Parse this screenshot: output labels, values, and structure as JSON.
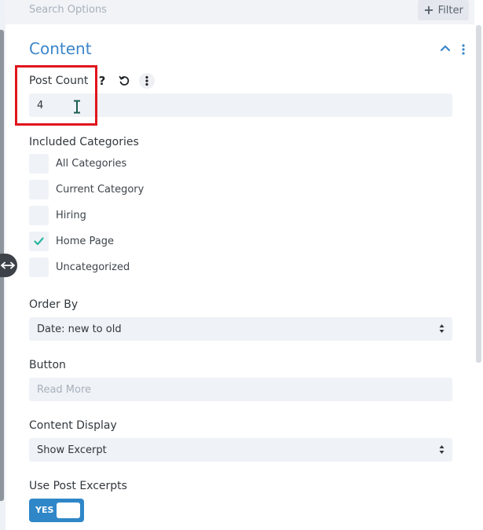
{
  "search": {
    "placeholder": "Search Options"
  },
  "filter": {
    "label": "Filter",
    "icon": "plus-icon"
  },
  "section": {
    "title": "Content",
    "collapse_icon": "chevron-up-icon",
    "menu_icon": "vertical-dots-icon"
  },
  "post_count": {
    "label": "Post Count",
    "value": "4",
    "icons": [
      "question-mark-icon",
      "reset-icon",
      "vertical-dots-icon"
    ]
  },
  "categories": {
    "label": "Included Categories",
    "items": [
      {
        "label": "All Categories",
        "checked": false
      },
      {
        "label": "Current Category",
        "checked": false
      },
      {
        "label": "Hiring",
        "checked": false
      },
      {
        "label": "Home Page",
        "checked": true
      },
      {
        "label": "Uncategorized",
        "checked": false
      }
    ]
  },
  "order_by": {
    "label": "Order By",
    "value": "Date: new to old"
  },
  "button": {
    "label": "Button",
    "placeholder": "Read More"
  },
  "content_display": {
    "label": "Content Display",
    "value": "Show Excerpt"
  },
  "use_post_excerpts": {
    "label": "Use Post Excerpts",
    "toggle": "YES",
    "enabled": true
  },
  "colors": {
    "accent": "#2f87c8",
    "title": "#3b86c9",
    "check": "#2bb5a0",
    "highlight": "#e0151d",
    "field_bg": "#eff2f6"
  }
}
